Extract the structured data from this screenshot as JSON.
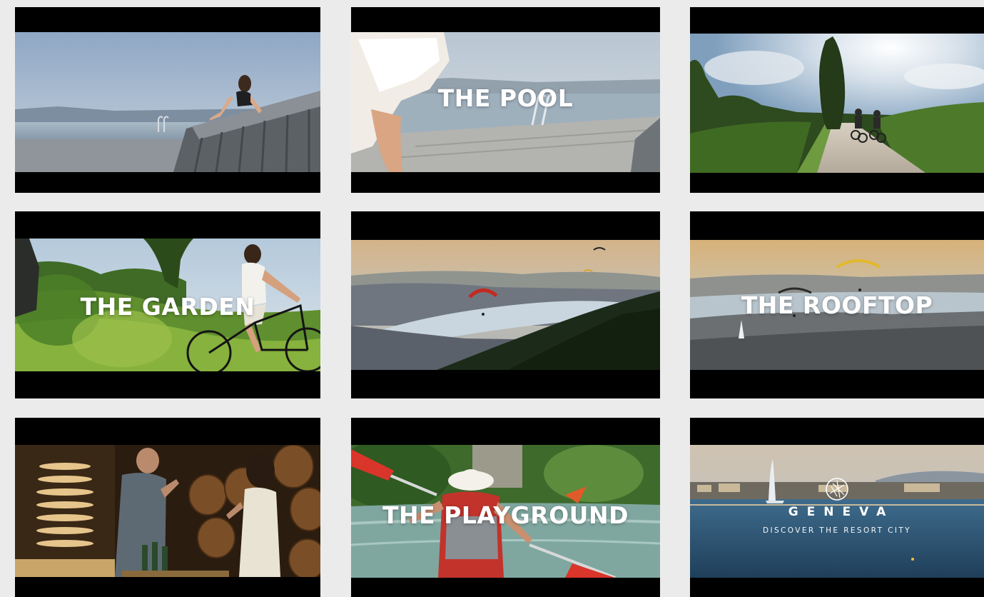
{
  "tiles": [
    {
      "id": "lake-sunbather",
      "scene": "woman-on-lake-deck-icon",
      "title": ""
    },
    {
      "id": "pool",
      "scene": "pool-deck-icon",
      "title": "THE POOL"
    },
    {
      "id": "vineyard-cyclists",
      "scene": "vineyard-path-icon",
      "title": ""
    },
    {
      "id": "garden",
      "scene": "cyclist-in-vineyard-icon",
      "title": "THE GARDEN"
    },
    {
      "id": "paragliders-lake",
      "scene": "paragliders-over-lake-icon",
      "title": ""
    },
    {
      "id": "rooftop",
      "scene": "paragliders-over-city-icon",
      "title": "THE ROOFTOP"
    },
    {
      "id": "wine-cellar",
      "scene": "wine-tasting-cellar-icon",
      "title": ""
    },
    {
      "id": "playground",
      "scene": "kayak-river-icon",
      "title": "THE PLAYGROUND"
    },
    {
      "id": "geneva",
      "scene": "geneva-jet-deau-icon",
      "title": ""
    }
  ],
  "geneva": {
    "brand": "GENEVA",
    "tagline": "DISCOVER THE RESORT CITY",
    "logo": "geneva-compass-logo-icon"
  },
  "colors": {
    "background": "#ebebeb",
    "letterbox": "#000000",
    "title_text": "#ffffff"
  }
}
